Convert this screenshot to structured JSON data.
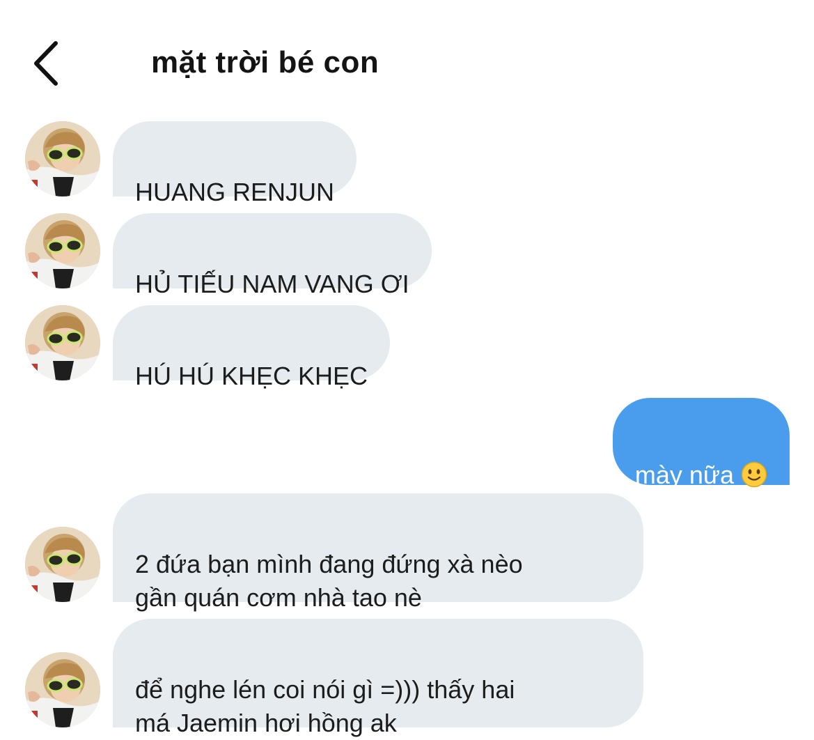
{
  "header": {
    "title": "mặt trời bé con",
    "back_icon": "chevron-left-icon"
  },
  "colors": {
    "incoming_bubble": "#e6ebef",
    "outgoing_bubble": "#4a9ded",
    "text": "#1c1c1c"
  },
  "messages": [
    {
      "direction": "incoming",
      "text": "HUANG RENJUN"
    },
    {
      "direction": "incoming",
      "text": "HỦ TIẾU NAM VANG ƠI"
    },
    {
      "direction": "incoming",
      "text": "HÚ HÚ KHẸC KHẸC"
    },
    {
      "direction": "outgoing",
      "text": "mày nữa",
      "emoji": "slightly-smiling-face-icon"
    },
    {
      "direction": "incoming",
      "text": "2 đứa bạn mình đang đứng xà nèo\ngần quán cơm nhà tao nè"
    },
    {
      "direction": "incoming",
      "text": "để nghe lén coi nói gì =))) thấy hai\nmá Jaemin hơi hồng ak"
    }
  ]
}
